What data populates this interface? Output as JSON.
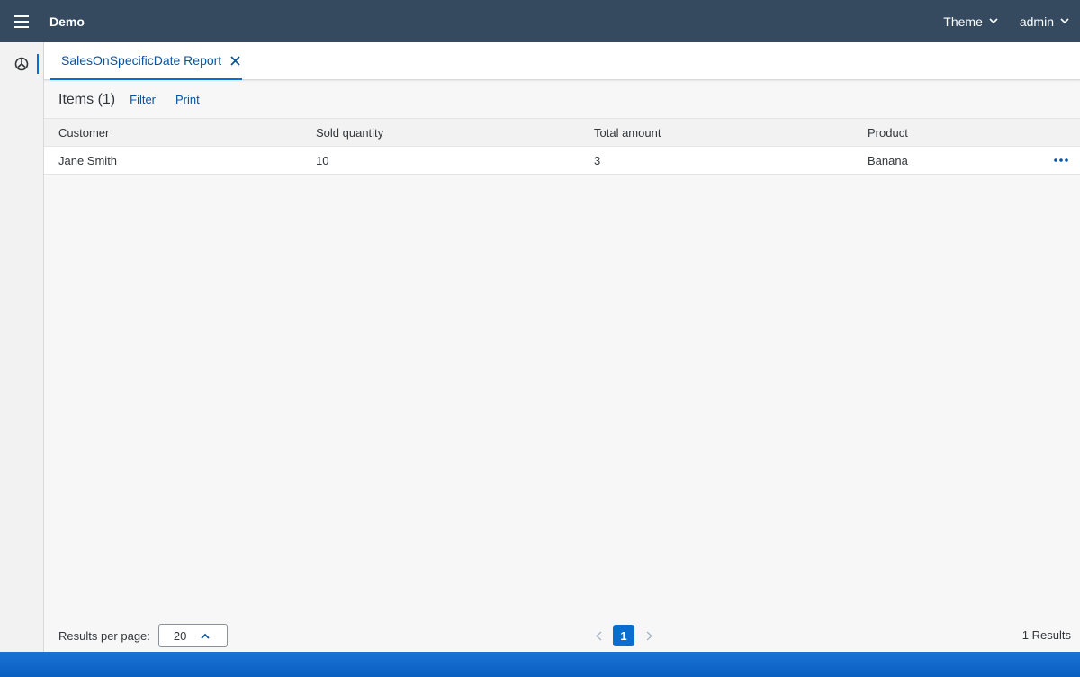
{
  "shell": {
    "title": "Demo",
    "menus": [
      {
        "label": "Theme"
      },
      {
        "label": "admin"
      }
    ]
  },
  "tabs": [
    {
      "label": "SalesOnSpecificDate Report",
      "active": true
    }
  ],
  "toolbar": {
    "title": "Items (1)",
    "filter_label": "Filter",
    "print_label": "Print"
  },
  "table": {
    "columns": [
      "Customer",
      "Sold quantity",
      "Total amount",
      "Product"
    ],
    "rows": [
      [
        "Jane Smith",
        "10",
        "3",
        "Banana"
      ]
    ]
  },
  "footer": {
    "results_per_page_label": "Results per page:",
    "results_per_page_value": "20",
    "current_page": "1",
    "results_label": "1 Results"
  },
  "icons": {
    "menu": "hamburger-menu-icon",
    "side": "dashboard-icon",
    "close": "close-icon",
    "more": "more-options-icon"
  },
  "colors": {
    "shell": "#354a5f",
    "accent": "#0a6ed1",
    "link": "#0854a0",
    "statusbar": "#0a5fc0"
  }
}
